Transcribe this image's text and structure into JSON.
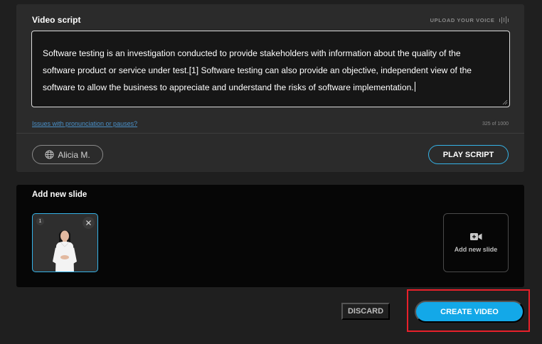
{
  "script": {
    "title": "Video script",
    "upload_voice_label": "UPLOAD YOUR VOICE",
    "text_lines": [
      "Software testing is an investigation conducted to provide stakeholders with information about the quality of the",
      "software product or service under test.[1] Software testing can also provide an objective, independent view of the",
      "software to allow the business to appreciate and understand the risks of software implementation."
    ],
    "issues_link": "Issues with pronunciation or pauses?",
    "char_count": "325 of 1000",
    "voice_name": "Alicia M.",
    "play_label": "PLAY SCRIPT"
  },
  "slides": {
    "title": "Add new slide",
    "items": [
      {
        "number": "1"
      }
    ],
    "add_label": "Add new slide"
  },
  "actions": {
    "discard_label": "DISCARD",
    "create_label": "CREATE VIDEO"
  },
  "colors": {
    "accent": "#13a8e8",
    "outline_accent": "#35b3e8",
    "highlight": "#e8202a",
    "background": "#1f1f1f",
    "panel": "#2b2b2b",
    "slides_panel": "#060606"
  },
  "icons": {
    "upload": "sound-wave-icon",
    "voice": "globe-icon",
    "slide_close": "close-icon",
    "add_slide": "add-video-icon"
  }
}
